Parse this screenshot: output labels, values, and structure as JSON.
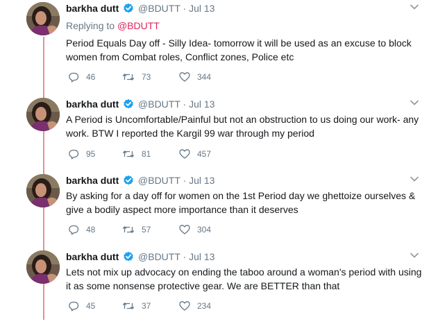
{
  "tweets": [
    {
      "name": "barkha dutt",
      "handle": "@BDUTT",
      "dot": "·",
      "date": "Jul 13",
      "replying_prefix": "Replying to",
      "replying_to": "@BDUTT",
      "text": "Period Equals Day off - Silly Idea- tomorrow it will be used as an excuse to block women from Combat roles, Conflict zones, Police etc",
      "replies": "46",
      "retweets": "73",
      "likes": "344"
    },
    {
      "name": "barkha dutt",
      "handle": "@BDUTT",
      "dot": "·",
      "date": "Jul 13",
      "text": "A Period is Uncomfortable/Painful but not an obstruction to us doing our work- any work. BTW I reported the Kargil 99 war through my period",
      "replies": "95",
      "retweets": "81",
      "likes": "457"
    },
    {
      "name": "barkha dutt",
      "handle": "@BDUTT",
      "dot": "·",
      "date": "Jul 13",
      "text": "By asking for a day off for women on the 1st Period day we ghettoize ourselves & give a bodily aspect more importance than it deserves",
      "replies": "48",
      "retweets": "57",
      "likes": "304"
    },
    {
      "name": "barkha dutt",
      "handle": "@BDUTT",
      "dot": "·",
      "date": "Jul 13",
      "text": "Lets not mix up advocacy on ending the taboo around a woman's period with using it as some nonsense protective gear. We are BETTER than that",
      "replies": "45",
      "retweets": "37",
      "likes": "234"
    }
  ],
  "colors": {
    "thread_line": "#e68d93",
    "verified": "#1da1f2",
    "mention": "#e0245e",
    "secondary_text": "#657786"
  },
  "icons": [
    "avatar-photo",
    "verified-badge-icon",
    "chevron-down-icon",
    "reply-icon",
    "retweet-icon",
    "like-icon"
  ]
}
